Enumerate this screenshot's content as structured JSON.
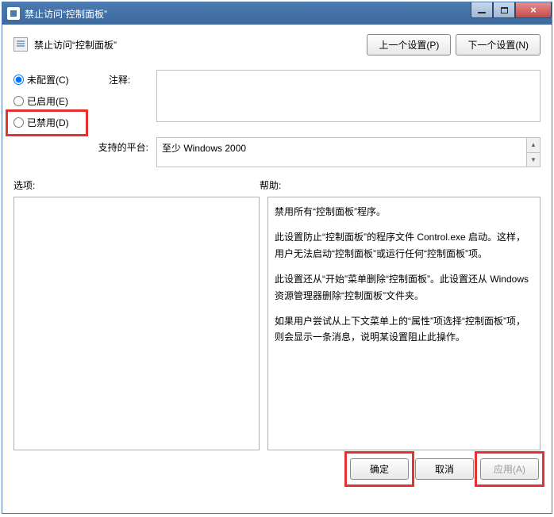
{
  "window": {
    "title": "禁止访问“控制面板”"
  },
  "header": {
    "policy_name": "禁止访问“控制面板”",
    "prev_button": "上一个设置(P)",
    "next_button": "下一个设置(N)"
  },
  "radios": {
    "not_configured": "未配置(C)",
    "enabled": "已启用(E)",
    "disabled": "已禁用(D)",
    "selected": "not_configured"
  },
  "labels": {
    "comment": "注释:",
    "platform": "支持的平台:",
    "options": "选项:",
    "help": "帮助:"
  },
  "platform_text": "至少 Windows 2000",
  "comment_text": "",
  "help": {
    "p1": "禁用所有“控制面板”程序。",
    "p2": "此设置防止“控制面板”的程序文件 Control.exe 启动。这样，用户无法启动“控制面板”或运行任何“控制面板”项。",
    "p3": "此设置还从“开始”菜单删除“控制面板”。此设置还从 Windows 资源管理器删除“控制面板”文件夹。",
    "p4": "如果用户尝试从上下文菜单上的“属性”项选择“控制面板”项，则会显示一条消息，说明某设置阻止此操作。"
  },
  "footer": {
    "ok": "确定",
    "cancel": "取消",
    "apply": "应用(A)"
  }
}
